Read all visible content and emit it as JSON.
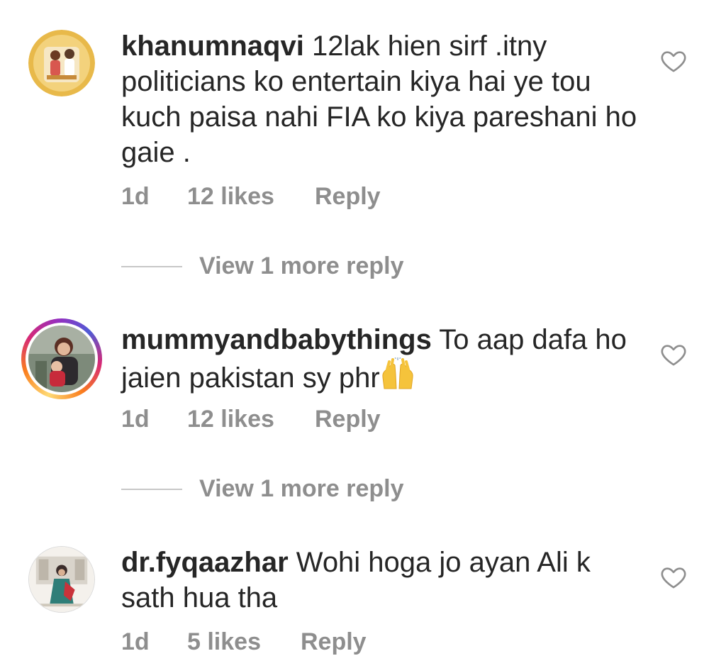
{
  "comments": [
    {
      "username": "khanumnaqvi",
      "text": "12lak hien sirf .itny politicians ko entertain kiya hai ye tou kuch paisa nahi FIA ko kiya pareshani ho gaie .",
      "time": "1d",
      "likes": "12 likes",
      "reply": "Reply",
      "view_more": "View 1 more reply"
    },
    {
      "username": "mummyandbabythings",
      "text": "To aap dafa ho jaien pakistan sy phr",
      "emoji_icon": "raising-hands-icon",
      "time": "1d",
      "likes": "12 likes",
      "reply": "Reply",
      "view_more": "View 1 more reply"
    },
    {
      "username": "dr.fyqaazhar",
      "text": "Wohi hoga jo ayan Ali k sath hua tha",
      "time": "1d",
      "likes": "5 likes",
      "reply": "Reply"
    }
  ],
  "colors": {
    "text": "#262626",
    "secondary": "#8e8e8e",
    "divider": "#c7c7c7",
    "story_ring": "#d62976"
  }
}
